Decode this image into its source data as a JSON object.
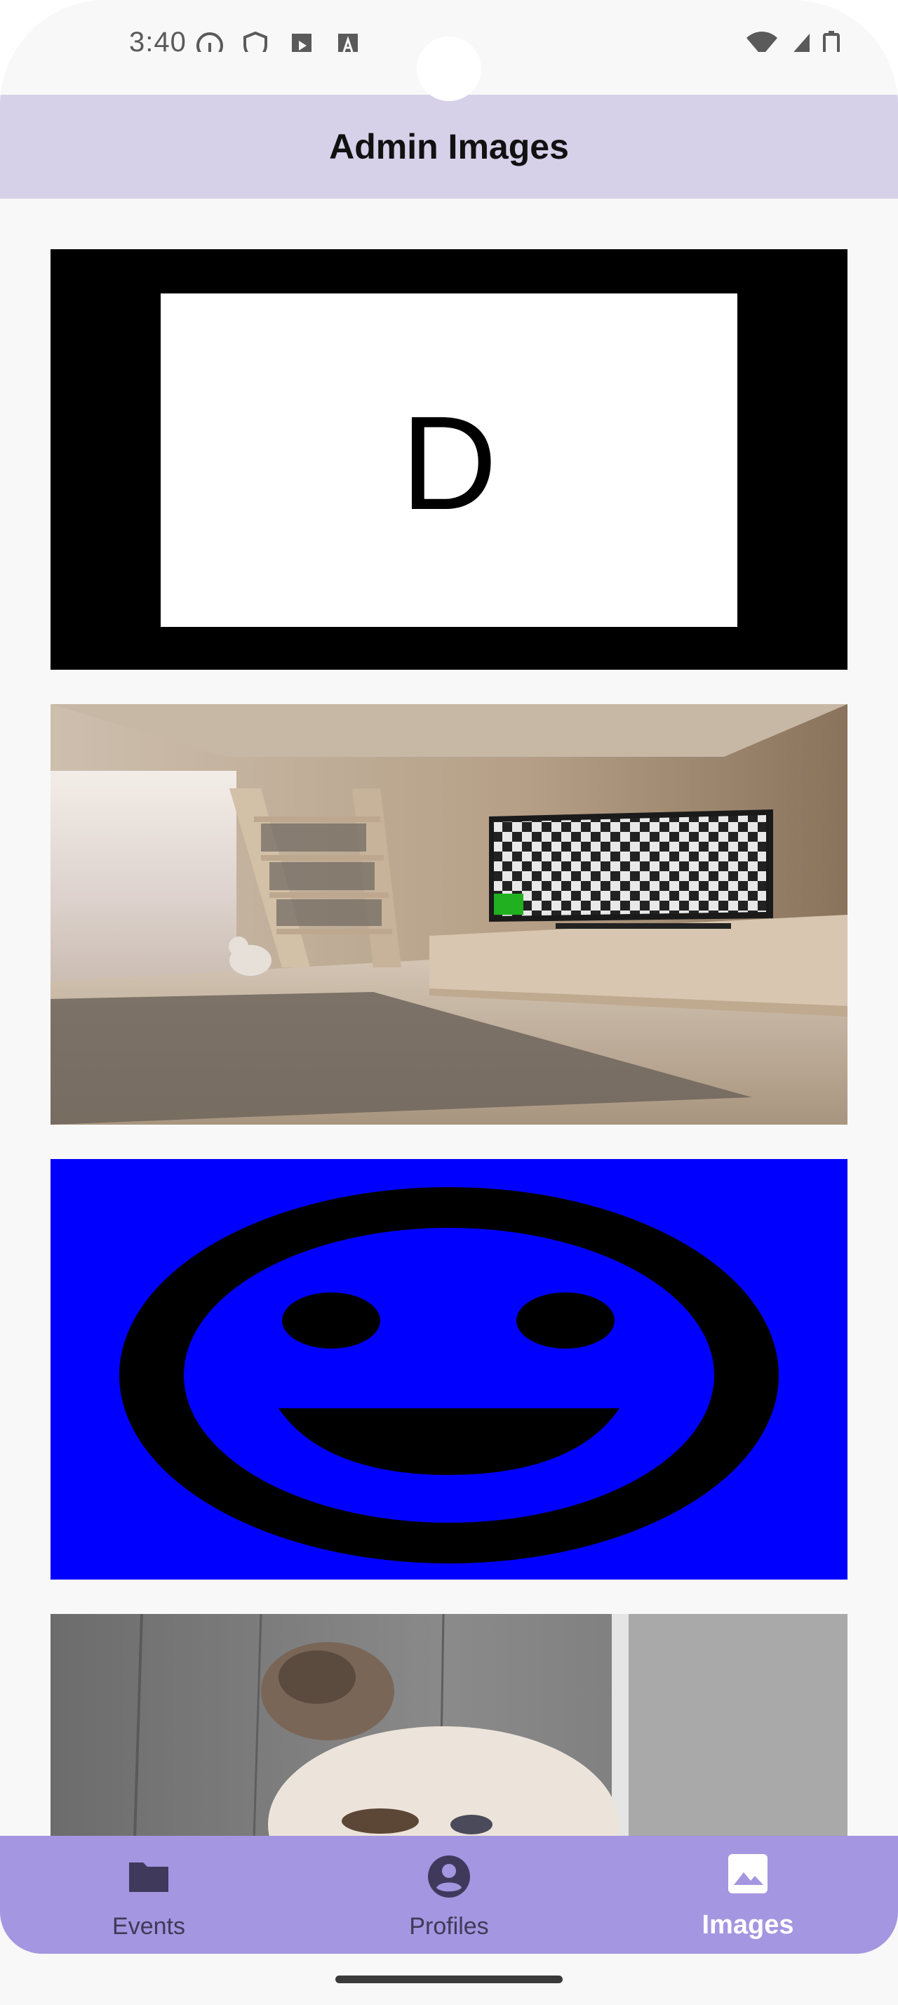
{
  "status_bar": {
    "time": "3:40"
  },
  "header": {
    "title": "Admin Images"
  },
  "images": [
    {
      "name": "letter-d-image",
      "letter": "D"
    },
    {
      "name": "living-room-image"
    },
    {
      "name": "smiley-face-image"
    },
    {
      "name": "cat-photo-image"
    }
  ],
  "bottom_nav": {
    "items": [
      {
        "label": "Events",
        "icon": "folder-icon",
        "active": false
      },
      {
        "label": "Profiles",
        "icon": "account-circle-icon",
        "active": false
      },
      {
        "label": "Images",
        "icon": "image-icon",
        "active": true
      }
    ]
  },
  "colors": {
    "app_bar": "#d6d1e9",
    "bottom_nav": "#a496e0",
    "smiley_background": "#0000ff"
  }
}
